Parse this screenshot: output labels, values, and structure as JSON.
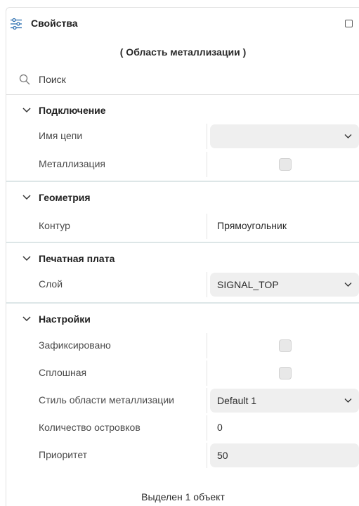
{
  "window": {
    "title": "Свойства",
    "subtitle": "( Область металлизации )"
  },
  "search": {
    "placeholder": "Поиск"
  },
  "sections": {
    "connection": {
      "title": "Подключение",
      "net_label": "Имя цепи",
      "net_value": "",
      "metallization_label": "Металлизация",
      "metallization_checked": false
    },
    "geometry": {
      "title": "Геометрия",
      "contour_label": "Контур",
      "contour_value": "Прямоугольник"
    },
    "pcb": {
      "title": "Печатная плата",
      "layer_label": "Слой",
      "layer_value": "SIGNAL_TOP"
    },
    "settings": {
      "title": "Настройки",
      "locked_label": "Зафиксировано",
      "locked_checked": false,
      "solid_label": "Сплошная",
      "solid_checked": false,
      "style_label": "Стиль области металлизации",
      "style_value": "Default 1",
      "islands_label": "Количество островков",
      "islands_value": "0",
      "priority_label": "Приоритет",
      "priority_value": "50"
    }
  },
  "status": "Выделен 1 объект",
  "icons": {
    "title": "sliders-icon",
    "window": "maximize-icon",
    "search": "search-icon",
    "section_toggle": "chevron-down-icon",
    "select": "chevron-down-icon"
  },
  "colors": {
    "section_separator": "#dde6e7",
    "field_bg": "#efefef"
  }
}
